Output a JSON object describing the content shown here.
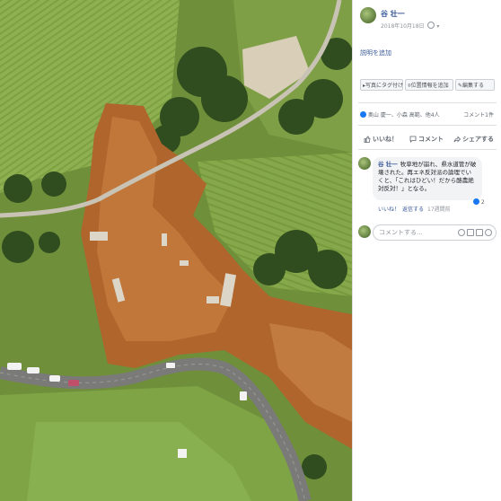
{
  "post": {
    "author": "谷 壮一",
    "date": "2018年10月18日",
    "privacy_icon": "globe-icon",
    "add_description": "説明を追加",
    "buttons": [
      "写真にタグ付け",
      "位置情報を追加",
      "編集する"
    ],
    "reactors": "奥山 慶一、小森 高範、他4人",
    "comment_count": "コメント1件",
    "actions": {
      "like": "いいね！",
      "comment": "コメント",
      "share": "シェアする"
    }
  },
  "comment": {
    "author": "谷 壮一",
    "text": "牧草地が崩れ、県水道管が破壊された。再エネ反対派の論理でいくと、「これはひどい！だから酪農絶対反対！」となる。",
    "like_label": "いいね！",
    "reply_label": "返信する",
    "time": "17週間前",
    "reaction_count": "2"
  },
  "comment_input": {
    "placeholder": "コメントする..."
  },
  "colors": {
    "link": "#385898",
    "grass": "#6f8f3a",
    "mud": "#b0652c",
    "road": "#7a7a78"
  }
}
